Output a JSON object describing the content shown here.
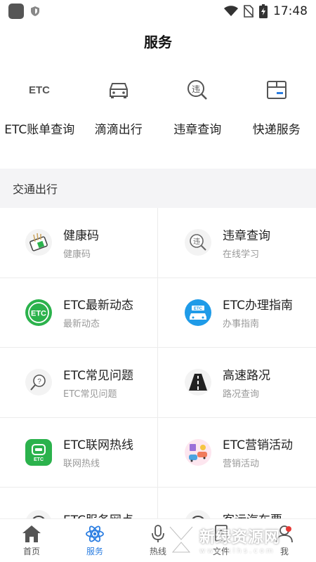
{
  "status_bar": {
    "time": "17:48"
  },
  "header": {
    "title": "服务"
  },
  "quick_actions": [
    {
      "label": "ETC账单查询",
      "icon": "etc-text-icon",
      "icon_text": "ETC"
    },
    {
      "label": "滴滴出行",
      "icon": "car-front-icon"
    },
    {
      "label": "违章查询",
      "icon": "violation-search-icon",
      "icon_text": "违"
    },
    {
      "label": "快递服务",
      "icon": "package-box-icon"
    }
  ],
  "section": {
    "title": "交通出行"
  },
  "services": [
    {
      "title": "健康码",
      "subtitle": "健康码",
      "icon": "health-code-icon"
    },
    {
      "title": "违章查询",
      "subtitle": "在线学习",
      "icon": "violation-search-icon",
      "icon_text": "违"
    },
    {
      "title": "ETC最新动态",
      "subtitle": "最新动态",
      "icon": "etc-green-badge-icon",
      "icon_text": "ETC"
    },
    {
      "title": "ETC办理指南",
      "subtitle": "办事指南",
      "icon": "etc-car-guide-icon",
      "icon_text": "ETC"
    },
    {
      "title": "ETC常见问题",
      "subtitle": "ETC常见问题",
      "icon": "question-magnifier-icon"
    },
    {
      "title": "高速路况",
      "subtitle": "路况查询",
      "icon": "highway-road-icon"
    },
    {
      "title": "ETC联网热线",
      "subtitle": "联网热线",
      "icon": "etc-hotline-icon",
      "icon_text": "ETC"
    },
    {
      "title": "ETC营销活动",
      "subtitle": "营销活动",
      "icon": "marketing-event-icon"
    },
    {
      "title": "ETC服务网点",
      "subtitle": "",
      "icon": "service-outlet-icon"
    },
    {
      "title": "客运汽车票",
      "subtitle": "",
      "icon": "bus-ticket-icon"
    }
  ],
  "bottom_nav": [
    {
      "label": "首页",
      "icon": "home-icon",
      "active": false
    },
    {
      "label": "服务",
      "icon": "atom-icon",
      "active": true
    },
    {
      "label": "热线",
      "icon": "microphone-icon",
      "active": false
    },
    {
      "label": "文件",
      "icon": "document-icon",
      "active": false
    },
    {
      "label": "我",
      "icon": "person-icon",
      "active": false
    }
  ],
  "watermark": {
    "main": "新绿资源网",
    "sub": "www.xlhs.com"
  },
  "colors": {
    "accent": "#2a7de1",
    "etc_green": "#2bb24c",
    "etc_blue": "#1f9be8",
    "section_bg": "#f4f4f6"
  }
}
